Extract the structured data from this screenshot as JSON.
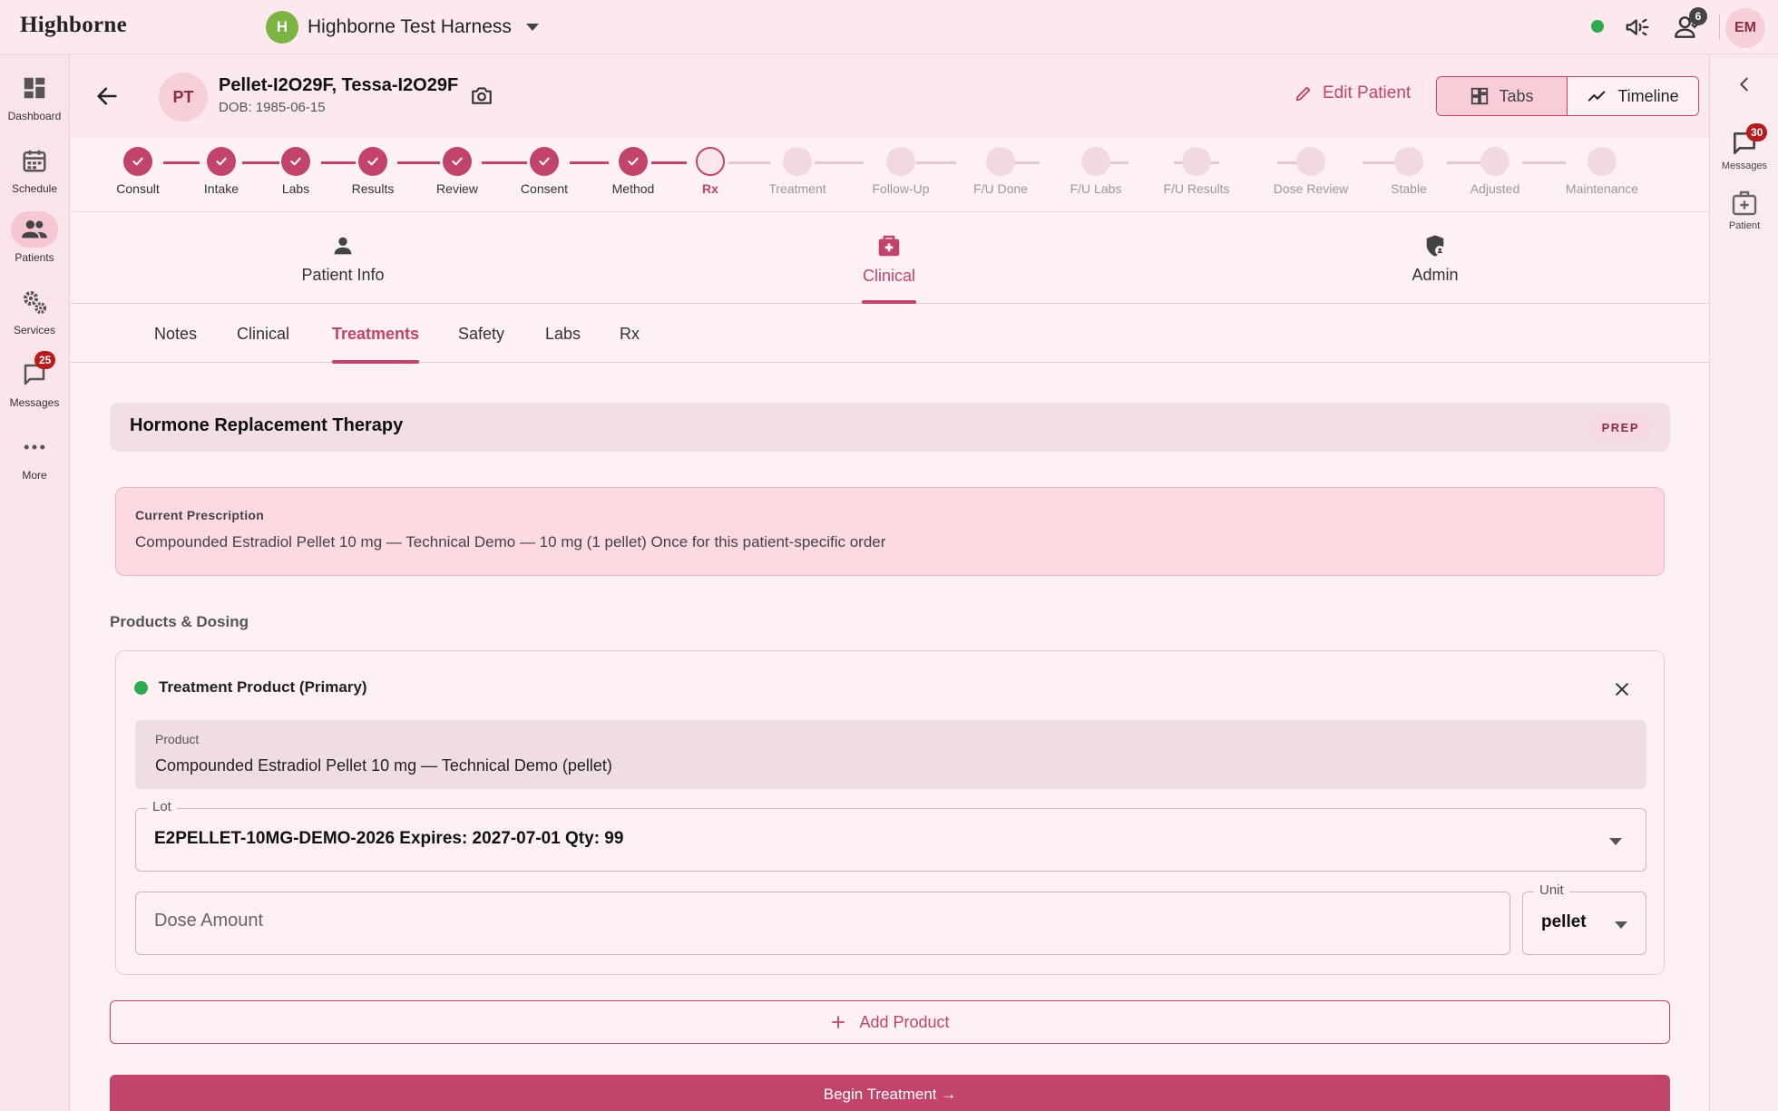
{
  "app": {
    "brand": "Highborne",
    "org_initial": "H",
    "org_name": "Highborne Test Harness",
    "notifications_count": "6",
    "user_initials": "EM"
  },
  "colors": {
    "accent": "#c2446b",
    "status_online": "#2eaa4f",
    "org_avatar": "#7cb342"
  },
  "nav": [
    {
      "label": "Dashboard",
      "icon": "dashboard-icon"
    },
    {
      "label": "Schedule",
      "icon": "calendar-icon"
    },
    {
      "label": "Patients",
      "icon": "people-icon",
      "active": true
    },
    {
      "label": "Services",
      "icon": "gears-icon"
    },
    {
      "label": "Messages",
      "icon": "chat-icon",
      "badge": "25"
    },
    {
      "label": "More",
      "icon": "more-icon"
    }
  ],
  "rail": {
    "messages_label": "Messages",
    "messages_badge": "30",
    "patient_label": "Patient"
  },
  "patient": {
    "initials": "PT",
    "name": "Pellet-I2O29F, Tessa-I2O29F",
    "dob": "DOB: 1985-06-15"
  },
  "header": {
    "edit_label": "Edit Patient",
    "tabs_label": "Tabs",
    "timeline_label": "Timeline"
  },
  "stepper": {
    "steps": [
      {
        "label": "Consult",
        "state": "done"
      },
      {
        "label": "Intake",
        "state": "done"
      },
      {
        "label": "Labs",
        "state": "done"
      },
      {
        "label": "Results",
        "state": "done"
      },
      {
        "label": "Review",
        "state": "done"
      },
      {
        "label": "Consent",
        "state": "done"
      },
      {
        "label": "Method",
        "state": "done"
      },
      {
        "label": "Rx",
        "state": "current"
      },
      {
        "label": "Treatment",
        "state": "todo"
      },
      {
        "label": "Follow-Up",
        "state": "todo"
      },
      {
        "label": "F/U Done",
        "state": "todo"
      },
      {
        "label": "F/U Labs",
        "state": "todo"
      },
      {
        "label": "F/U Results",
        "state": "todo"
      },
      {
        "label": "Dose Review",
        "state": "todo"
      },
      {
        "label": "Stable",
        "state": "todo"
      },
      {
        "label": "Adjusted",
        "state": "todo"
      },
      {
        "label": "Maintenance",
        "state": "todo"
      }
    ]
  },
  "main_tabs": [
    {
      "label": "Patient Info",
      "icon": "person-icon"
    },
    {
      "label": "Clinical",
      "icon": "medical-kit-icon",
      "active": true
    },
    {
      "label": "Admin",
      "icon": "admin-shield-icon"
    }
  ],
  "sub_tabs": [
    {
      "label": "Notes"
    },
    {
      "label": "Clinical"
    },
    {
      "label": "Treatments",
      "active": true
    },
    {
      "label": "Safety"
    },
    {
      "label": "Labs"
    },
    {
      "label": "Rx"
    }
  ],
  "section": {
    "title": "Hormone Replacement Therapy",
    "badge": "PREP"
  },
  "prescription": {
    "label": "Current Prescription",
    "value": "Compounded Estradiol Pellet 10 mg — Technical Demo — 10 mg (1 pellet) Once for this patient-specific order"
  },
  "products": {
    "heading": "Products & Dosing",
    "item": {
      "title": "Treatment Product (Primary)",
      "product_label": "Product",
      "product_value": "Compounded Estradiol Pellet 10 mg — Technical Demo (pellet)",
      "lot_label": "Lot",
      "lot_value": "E2PELLET-10MG-DEMO-2026  Expires: 2027-07-01  Qty: 99",
      "dose_placeholder": "Dose Amount",
      "unit_label": "Unit",
      "unit_value": "pellet"
    },
    "add_label": "Add Product"
  },
  "actions": {
    "begin_label": "Begin Treatment →"
  }
}
